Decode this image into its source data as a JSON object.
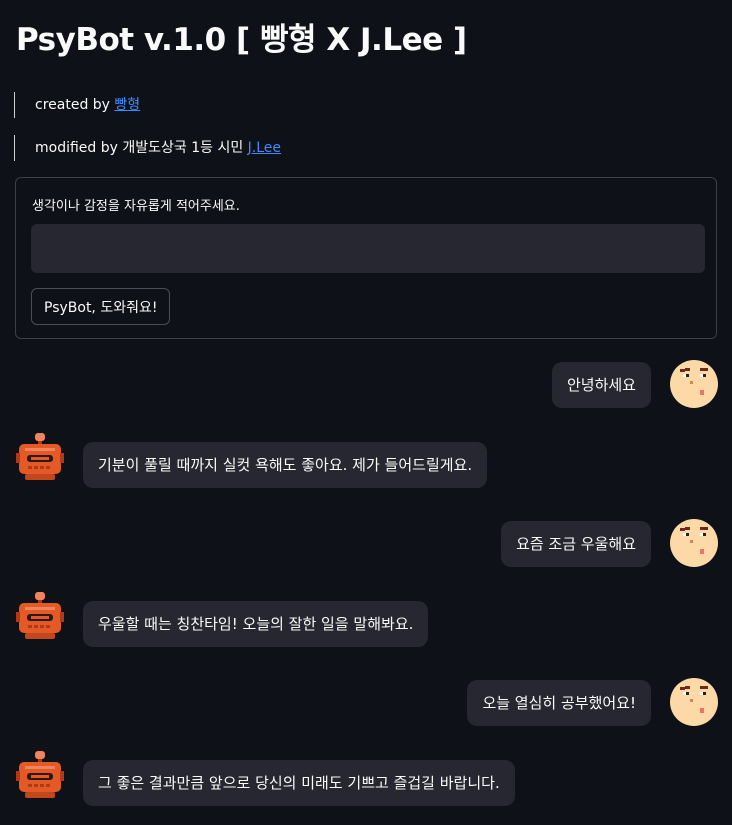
{
  "page": {
    "title": "PsyBot v.1.0 [ 빵형 X J.Lee ]"
  },
  "credits": {
    "created_prefix": "created by ",
    "created_link": "빵형",
    "modified_prefix": "modified by 개발도상국 1등 시민 ",
    "modified_link": "J.Lee"
  },
  "form": {
    "label": "생각이나 감정을 자유롭게 적어주세요.",
    "input_value": "",
    "input_placeholder": "",
    "submit_label": "PsyBot, 도와줘요!"
  },
  "chat": {
    "messages": [
      {
        "role": "user",
        "text": "안녕하세요"
      },
      {
        "role": "bot",
        "text": "기분이 풀릴 때까지 실컷 욕해도 좋아요. 제가 들어드릴게요."
      },
      {
        "role": "user",
        "text": "요즘 조금 우울해요"
      },
      {
        "role": "bot",
        "text": "우울할 때는 칭찬타임! 오늘의 잘한 일을 말해봐요."
      },
      {
        "role": "user",
        "text": "오늘 열심히 공부했어요!"
      },
      {
        "role": "bot",
        "text": "그 좋은 결과만큼 앞으로 당신의 미래도 기쁘고 즐겁길 바랍니다."
      }
    ]
  },
  "colors": {
    "background": "#0e1117",
    "bubble": "#262730",
    "link": "#3d8bff",
    "user_avatar_skin": "#fdd9a8",
    "bot_avatar": "#e35a27"
  },
  "icons": {
    "user_avatar": "pixel-face-avatar-icon",
    "bot_avatar": "pixel-robot-avatar-icon"
  }
}
